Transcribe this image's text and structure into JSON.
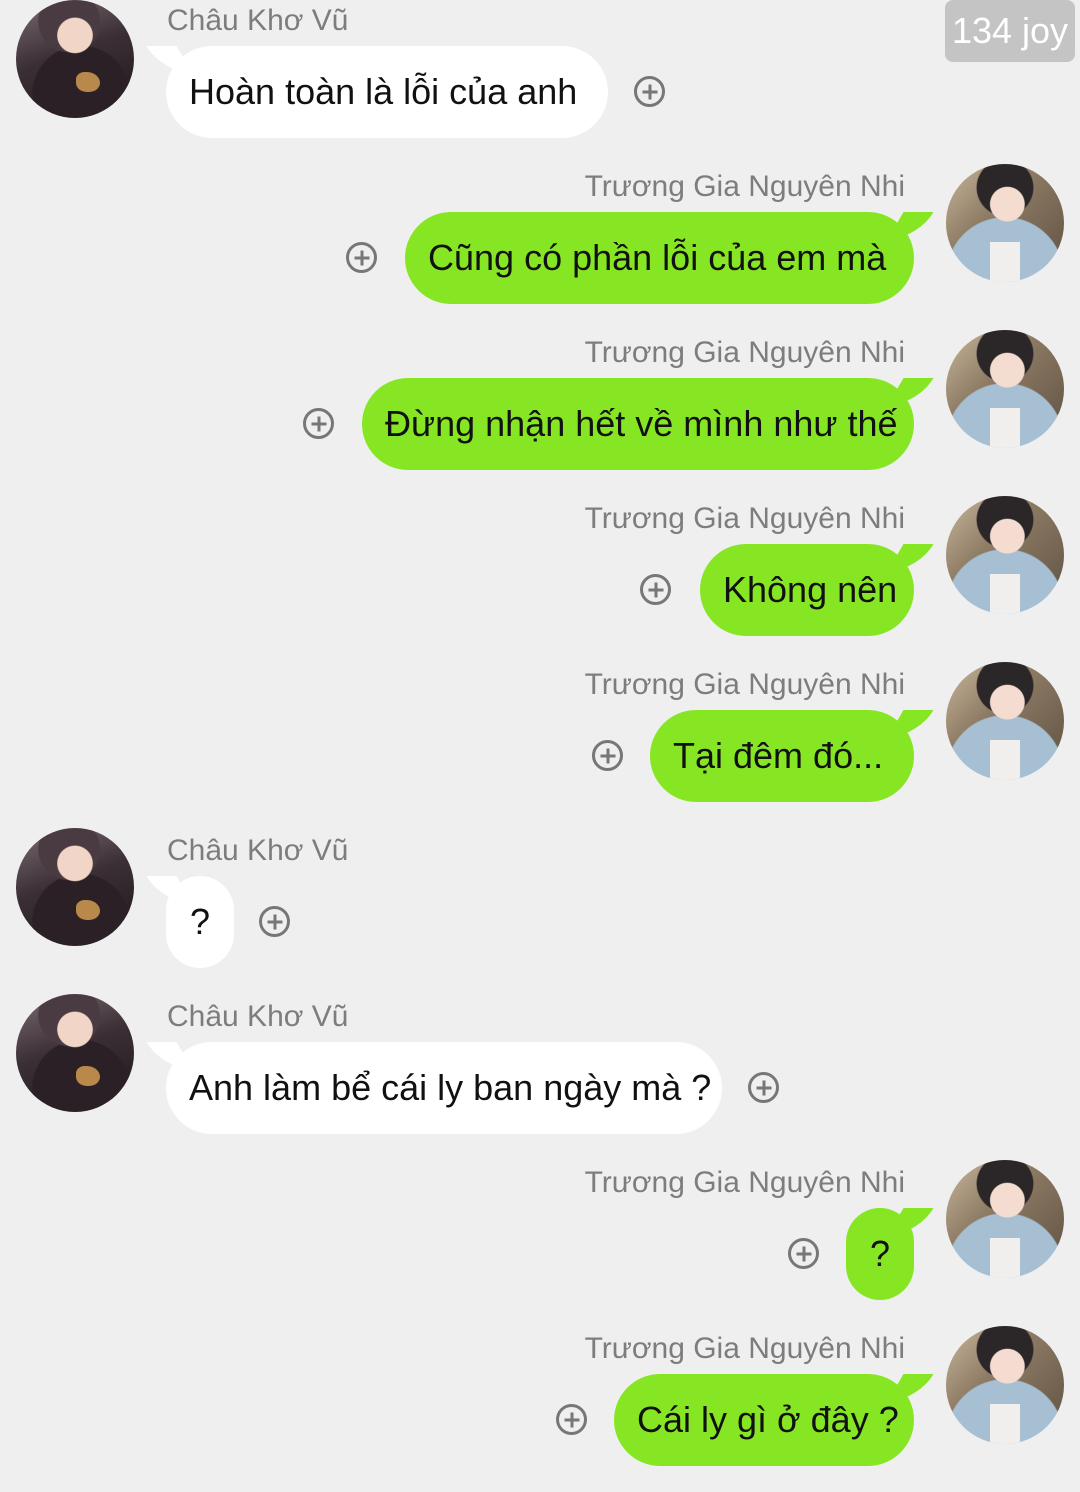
{
  "badge": "134 joy",
  "contacts": {
    "left_name": "Châu Khơ Vũ",
    "right_name": "Trương Gia Nguyên Nhi"
  },
  "messages": [
    {
      "side": "left",
      "name": "Châu Khơ Vũ",
      "text": "Hoàn toàn là lỗi của anh"
    },
    {
      "side": "right",
      "name": "Trương Gia Nguyên Nhi",
      "text": "Cũng có phần lỗi của em mà"
    },
    {
      "side": "right",
      "name": "Trương Gia Nguyên Nhi",
      "text": "Đừng nhận hết về mình như thế"
    },
    {
      "side": "right",
      "name": "Trương Gia Nguyên Nhi",
      "text": "Không nên"
    },
    {
      "side": "right",
      "name": "Trương Gia Nguyên Nhi",
      "text": "Tại đêm đó..."
    },
    {
      "side": "left",
      "name": "Châu Khơ Vũ",
      "text": "?"
    },
    {
      "side": "left",
      "name": "Châu Khơ Vũ",
      "text": "Anh làm bể cái ly ban ngày mà ?"
    },
    {
      "side": "right",
      "name": "Trương Gia Nguyên Nhi",
      "text": "?"
    },
    {
      "side": "right",
      "name": "Trương Gia Nguyên Nhi",
      "text": "Cái ly gì ở đây ?"
    }
  ]
}
